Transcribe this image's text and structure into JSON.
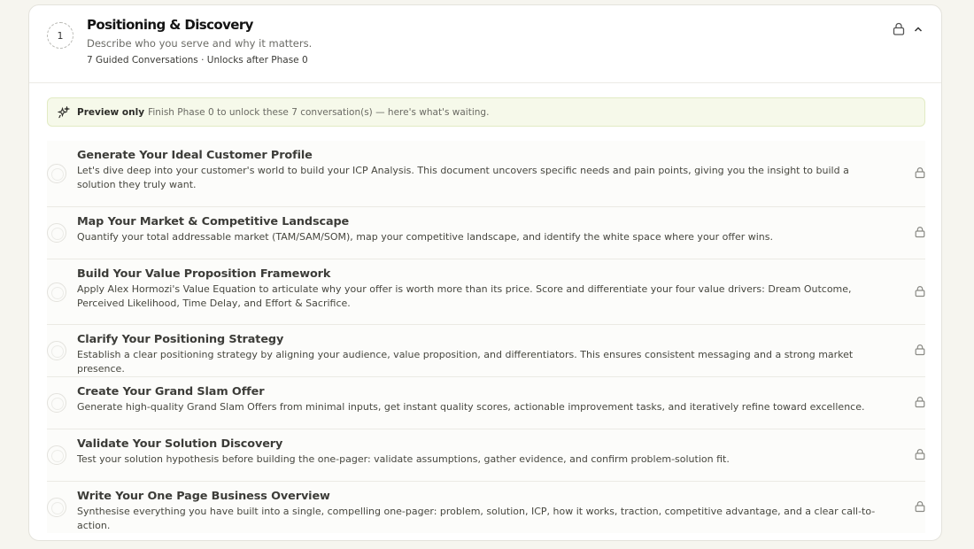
{
  "phase": {
    "number": "1",
    "title": "Positioning & Discovery",
    "description": "Describe who you serve and why it matters.",
    "meta": "7 Guided Conversations · Unlocks after Phase 0"
  },
  "banner": {
    "strong": "Preview only",
    "text": "Finish Phase 0 to unlock these 7 conversation(s) — here's what's waiting."
  },
  "icons": {
    "header_lock": "lock-icon",
    "collapse": "chevron-up-icon",
    "banner": "sparkle-icon",
    "item_lock": "lock-icon"
  },
  "colors": {
    "background": "#f6f5ef",
    "banner_bg": "#f6f9ea",
    "banner_border": "#e2ebc4"
  },
  "conversations": [
    {
      "title": "Generate Your Ideal Customer Profile",
      "description": "Let's dive deep into your customer's world to build your ICP Analysis. This document uncovers specific needs and pain points, giving you the insight to build a solution they truly want."
    },
    {
      "title": "Map Your Market & Competitive Landscape",
      "description": "Quantify your total addressable market (TAM/SAM/SOM), map your competitive landscape, and identify the white space where your offer wins."
    },
    {
      "title": "Build Your Value Proposition Framework",
      "description": "Apply Alex Hormozi's Value Equation to articulate why your offer is worth more than its price. Score and differentiate your four value drivers: Dream Outcome, Perceived Likelihood, Time Delay, and Effort & Sacrifice."
    },
    {
      "title": "Clarify Your Positioning Strategy",
      "description": "Establish a clear positioning strategy by aligning your audience, value proposition, and differentiators. This ensures consistent messaging and a strong market presence."
    },
    {
      "title": "Create Your Grand Slam Offer",
      "description": "Generate high-quality Grand Slam Offers from minimal inputs, get instant quality scores, actionable improvement tasks, and iteratively refine toward excellence."
    },
    {
      "title": "Validate Your Solution Discovery",
      "description": "Test your solution hypothesis before building the one-pager: validate assumptions, gather evidence, and confirm problem-solution fit."
    },
    {
      "title": "Write Your One Page Business Overview",
      "description": "Synthesise everything you have built into a single, compelling one-pager: problem, solution, ICP, how it works, traction, competitive advantage, and a clear call-to-action."
    }
  ]
}
